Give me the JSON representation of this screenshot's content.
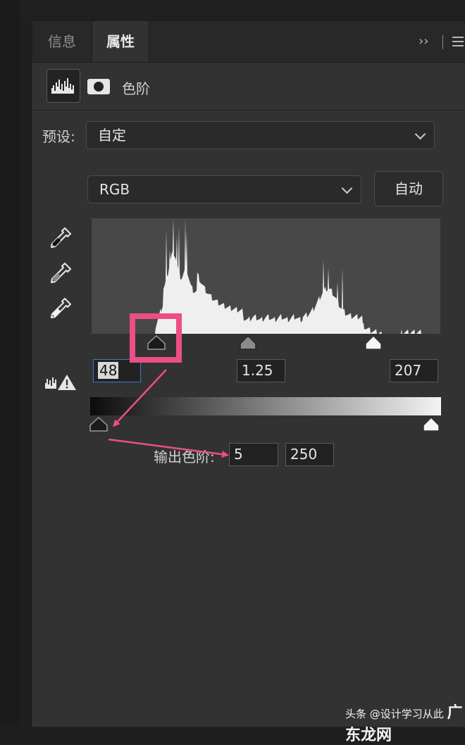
{
  "tabs": [
    {
      "label": "信息",
      "active": false
    },
    {
      "label": "属性",
      "active": true
    }
  ],
  "panel": {
    "more_glyph": "››",
    "adjustment_title": "色阶",
    "icons": [
      "levels-histogram-icon",
      "layer-mask-icon"
    ]
  },
  "preset": {
    "label": "预设:",
    "value": "自定"
  },
  "channel": {
    "value": "RGB"
  },
  "auto_button": "自动",
  "histogram": {
    "color": "#efefef",
    "background": "#484848"
  },
  "input_levels": {
    "black": "48",
    "gamma": "1.25",
    "white": "207"
  },
  "output_levels": {
    "label": "输出色阶:",
    "black": "5",
    "white": "250"
  },
  "annotation": {
    "color": "#ec4e87"
  },
  "watermark": {
    "prefix": "头条 @",
    "handle": "设计学习从此",
    "site": "广东龙网"
  }
}
